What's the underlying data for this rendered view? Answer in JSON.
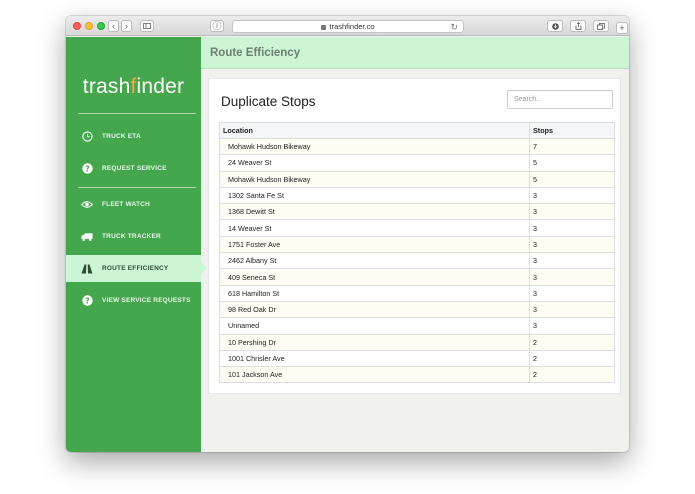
{
  "browser": {
    "url": "trashfinder.co"
  },
  "sidebar": {
    "logo": {
      "left": "trash",
      "mid": "f",
      "right": "inder"
    },
    "items": [
      {
        "label": "TRUCK ETA",
        "icon": "clock-icon"
      },
      {
        "label": "REQUEST SERVICE",
        "icon": "question-icon"
      },
      {
        "label": "FLEET WATCH",
        "icon": "eye-icon"
      },
      {
        "label": "TRUCK TRACKER",
        "icon": "truck-icon"
      },
      {
        "label": "ROUTE EFFICIENCY",
        "icon": "road-icon"
      },
      {
        "label": "VIEW SERVICE REQUESTS",
        "icon": "question-icon"
      }
    ]
  },
  "header": {
    "title": "Route Efficiency"
  },
  "card": {
    "title": "Duplicate Stops",
    "search_placeholder": "Search...",
    "columns": [
      "Location",
      "Stops"
    ],
    "rows": [
      {
        "location": "Mohawk Hudson Bikeway",
        "stops": "7"
      },
      {
        "location": "24 Weaver St",
        "stops": "5"
      },
      {
        "location": "Mohawk Hudson Bikeway",
        "stops": "5"
      },
      {
        "location": "1302 Santa Fe St",
        "stops": "3"
      },
      {
        "location": "1368 Dewitt St",
        "stops": "3"
      },
      {
        "location": "14 Weaver St",
        "stops": "3"
      },
      {
        "location": "1751 Foster Ave",
        "stops": "3"
      },
      {
        "location": "2462 Albany St",
        "stops": "3"
      },
      {
        "location": "409 Seneca St",
        "stops": "3"
      },
      {
        "location": "618 Hamilton St",
        "stops": "3"
      },
      {
        "location": "98 Red Oak Dr",
        "stops": "3"
      },
      {
        "location": "Unnamed",
        "stops": "3"
      },
      {
        "location": "10 Pershing Dr",
        "stops": "2"
      },
      {
        "location": "1001 Chrisler Ave",
        "stops": "2"
      },
      {
        "location": "101 Jackson Ave",
        "stops": "2"
      }
    ]
  },
  "colors": {
    "sidebar_bg": "#45a74d",
    "active_bg": "#ccf5d5",
    "logo_accent": "#f2a93b"
  }
}
